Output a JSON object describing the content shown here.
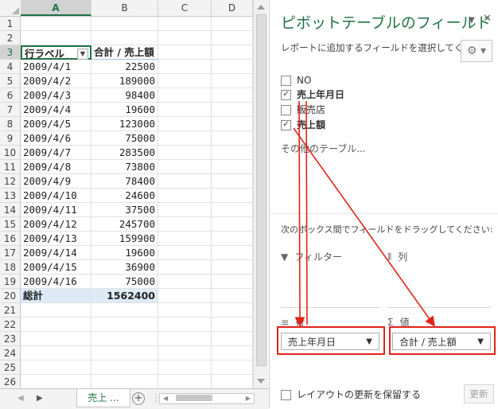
{
  "sheet": {
    "columns": [
      "A",
      "B",
      "C",
      "D"
    ],
    "row_numbers": [
      "1",
      "2",
      "3",
      "4",
      "5",
      "6",
      "7",
      "8",
      "9",
      "10",
      "11",
      "12",
      "13",
      "14",
      "15",
      "16",
      "17",
      "18",
      "19",
      "20",
      "21",
      "22",
      "23",
      "24",
      "25",
      "26"
    ],
    "pivot_header": {
      "row_label": "行ラベル",
      "value_label": "合計 / 売上額"
    },
    "pivot_rows": [
      {
        "date": "2009/4/1",
        "amount": "22500"
      },
      {
        "date": "2009/4/2",
        "amount": "189000"
      },
      {
        "date": "2009/4/3",
        "amount": "98400"
      },
      {
        "date": "2009/4/4",
        "amount": "19600"
      },
      {
        "date": "2009/4/5",
        "amount": "123000"
      },
      {
        "date": "2009/4/6",
        "amount": "75000"
      },
      {
        "date": "2009/4/7",
        "amount": "283500"
      },
      {
        "date": "2009/4/8",
        "amount": "73800"
      },
      {
        "date": "2009/4/9",
        "amount": "78400"
      },
      {
        "date": "2009/4/10",
        "amount": "24600"
      },
      {
        "date": "2009/4/11",
        "amount": "37500"
      },
      {
        "date": "2009/4/12",
        "amount": "245700"
      },
      {
        "date": "2009/4/13",
        "amount": "159900"
      },
      {
        "date": "2009/4/14",
        "amount": "19600"
      },
      {
        "date": "2009/4/15",
        "amount": "36900"
      },
      {
        "date": "2009/4/16",
        "amount": "75000"
      }
    ],
    "total": {
      "label": "総計",
      "amount": "1562400"
    },
    "tab": {
      "sheet_name": "売上 ...",
      "add": "+"
    }
  },
  "pane": {
    "title": "ピボットテーブルのフィールド",
    "subtitle": "レポートに追加するフィールドを選択してください:",
    "fields": [
      {
        "name": "NO",
        "checked": false
      },
      {
        "name": "売上年月日",
        "checked": true
      },
      {
        "name": "販売店",
        "checked": false
      },
      {
        "name": "売上額",
        "checked": true
      }
    ],
    "more_tables": "その他のテーブル...",
    "drag_instruction": "次のボックス間でフィールドをドラッグしてください:",
    "areas": {
      "filters": "フィルター",
      "columns": "列",
      "rows": "行",
      "values": "値"
    },
    "row_field": "売上年月日",
    "value_field": "合計 / 売上額",
    "defer_update": "レイアウトの更新を保留する",
    "update_button": "更新"
  },
  "colors": {
    "excel_green": "#217346",
    "annotation_red": "#e2231a",
    "pivot_header_blue": "#ddebf7"
  },
  "icons": [
    "close-icon",
    "dropdown-icon",
    "gear-icon",
    "filter-icon",
    "columns-icon",
    "rows-icon",
    "sigma-icon"
  ]
}
